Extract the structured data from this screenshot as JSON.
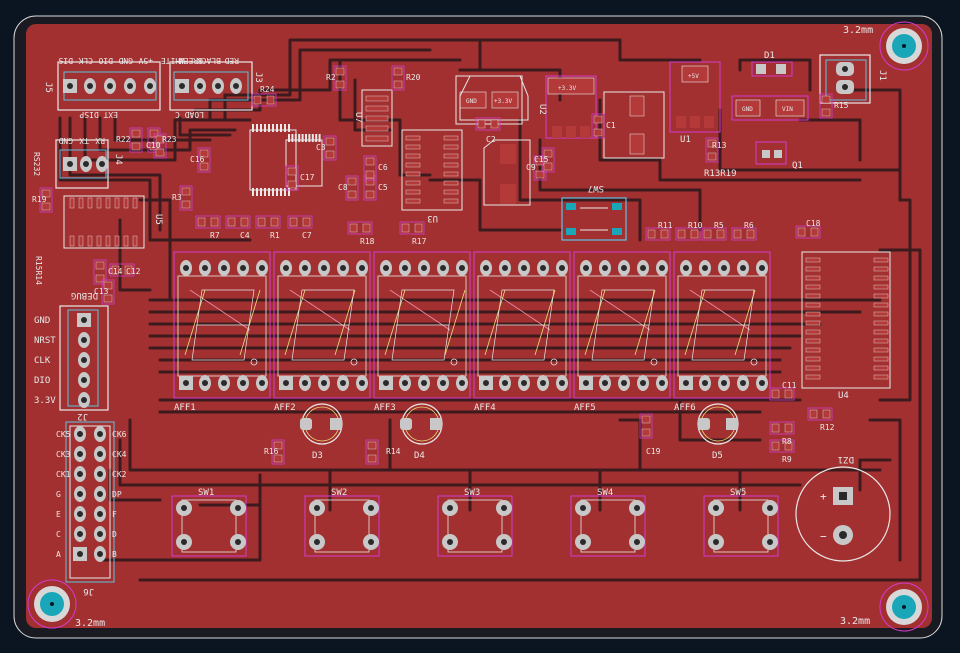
{
  "mount_holes": {
    "top_right": "3.2mm",
    "bottom_left": "3.2mm",
    "bottom_right": "3.2mm"
  },
  "connectors": {
    "j5": {
      "ref": "J5",
      "title": "EXT_DISP",
      "pins": [
        "DIS",
        "CLK",
        "DIO",
        "GND",
        "+5V"
      ]
    },
    "j3": {
      "ref": "J3",
      "title": "LOAD_C",
      "pins": [
        "WHITE",
        "GREEN",
        "BLACK",
        "RED"
      ]
    },
    "j4": {
      "ref": "J4",
      "title": "RS232",
      "pins": [
        "GND",
        "TX",
        "RX"
      ]
    },
    "j1": {
      "ref": "J1"
    },
    "debug": {
      "ref": "J2",
      "title": "DEBUG",
      "pins": [
        "GND",
        "NRST",
        "CLK",
        "DIO",
        "3.3V"
      ]
    },
    "j6": {
      "ref": "J6",
      "left_pins": [
        "CK5",
        "CK3",
        "CK1",
        "G",
        "E",
        "C",
        "A"
      ],
      "right_pins": [
        "CK6",
        "CK4",
        "CK2",
        "DP",
        "F",
        "D",
        "B"
      ]
    }
  },
  "displays": [
    "AFF1",
    "AFF2",
    "AFF3",
    "AFF4",
    "AFF5",
    "AFF6"
  ],
  "switches": [
    "SW1",
    "SW2",
    "SW3",
    "SW4",
    "SW5"
  ],
  "switch7": "SW7",
  "leds": {
    "d3": "D3",
    "d4": "D4",
    "d5": "D5",
    "d1": "D1",
    "dz1": "DZ1"
  },
  "ics": {
    "u1": "U1",
    "u2": "U2",
    "u3": "U3",
    "u4": "U4",
    "u5": "U5",
    "u7": "U7",
    "q1": "Q1"
  },
  "regulators": {
    "u1_label": "+5V",
    "u2_label": "+3.3V",
    "gnd": "GND",
    "vin": "VIN",
    "vout": "+3.3V"
  },
  "passives": [
    "R24",
    "R22",
    "R23",
    "R2",
    "R20",
    "R3",
    "R7",
    "C4",
    "R1",
    "C7",
    "R18",
    "R17",
    "R11",
    "R10",
    "R5",
    "R6",
    "C18",
    "R13",
    "R19",
    "C14",
    "C11",
    "R8",
    "R9",
    "R12",
    "C19",
    "R16",
    "R14",
    "R15",
    "C1",
    "C2",
    "C3",
    "C5",
    "C6",
    "C8",
    "C9",
    "C10",
    "C12",
    "C13",
    "C15",
    "C16",
    "C17"
  ],
  "labels": {
    "r13r19": "R13R19",
    "r15r14": "R15R14"
  },
  "colors": {
    "background": "#0b1522",
    "board": "#9b2a2a",
    "copper_fill": "#a83030",
    "track": "#4a1e22",
    "pad": "#c8c8c8",
    "silk": "#e8e8e8",
    "courtyard": "#d63acf",
    "fab": "#eaeaea",
    "hole": "#19a6b8"
  }
}
